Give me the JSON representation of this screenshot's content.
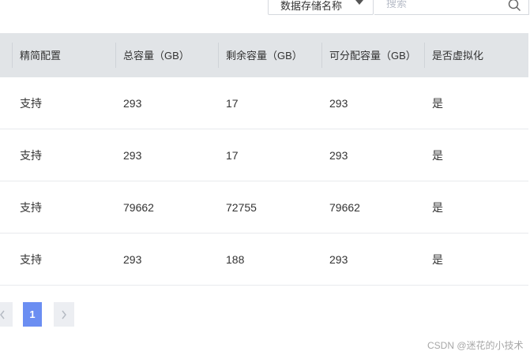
{
  "toolbar": {
    "filter_select": {
      "selected": "数据存储名称"
    },
    "search": {
      "placeholder": "搜索"
    }
  },
  "table": {
    "columns": [
      "精简配置",
      "总容量（GB）",
      "剩余容量（GB）",
      "可分配容量（GB）",
      "是否虚拟化"
    ],
    "rows": [
      [
        "支持",
        "293",
        "17",
        "293",
        "是"
      ],
      [
        "支持",
        "293",
        "17",
        "293",
        "是"
      ],
      [
        "支持",
        "79662",
        "72755",
        "79662",
        "是"
      ],
      [
        "支持",
        "293",
        "188",
        "293",
        "是"
      ]
    ]
  },
  "pagination": {
    "current_page": "1",
    "prev_icon": "chevron-left-icon",
    "next_icon": "chevron-right-icon"
  },
  "watermark": "CSDN @迷花的小技术",
  "colors": {
    "header_bg": "#e1e4e7",
    "accent": "#6b8ef2"
  }
}
